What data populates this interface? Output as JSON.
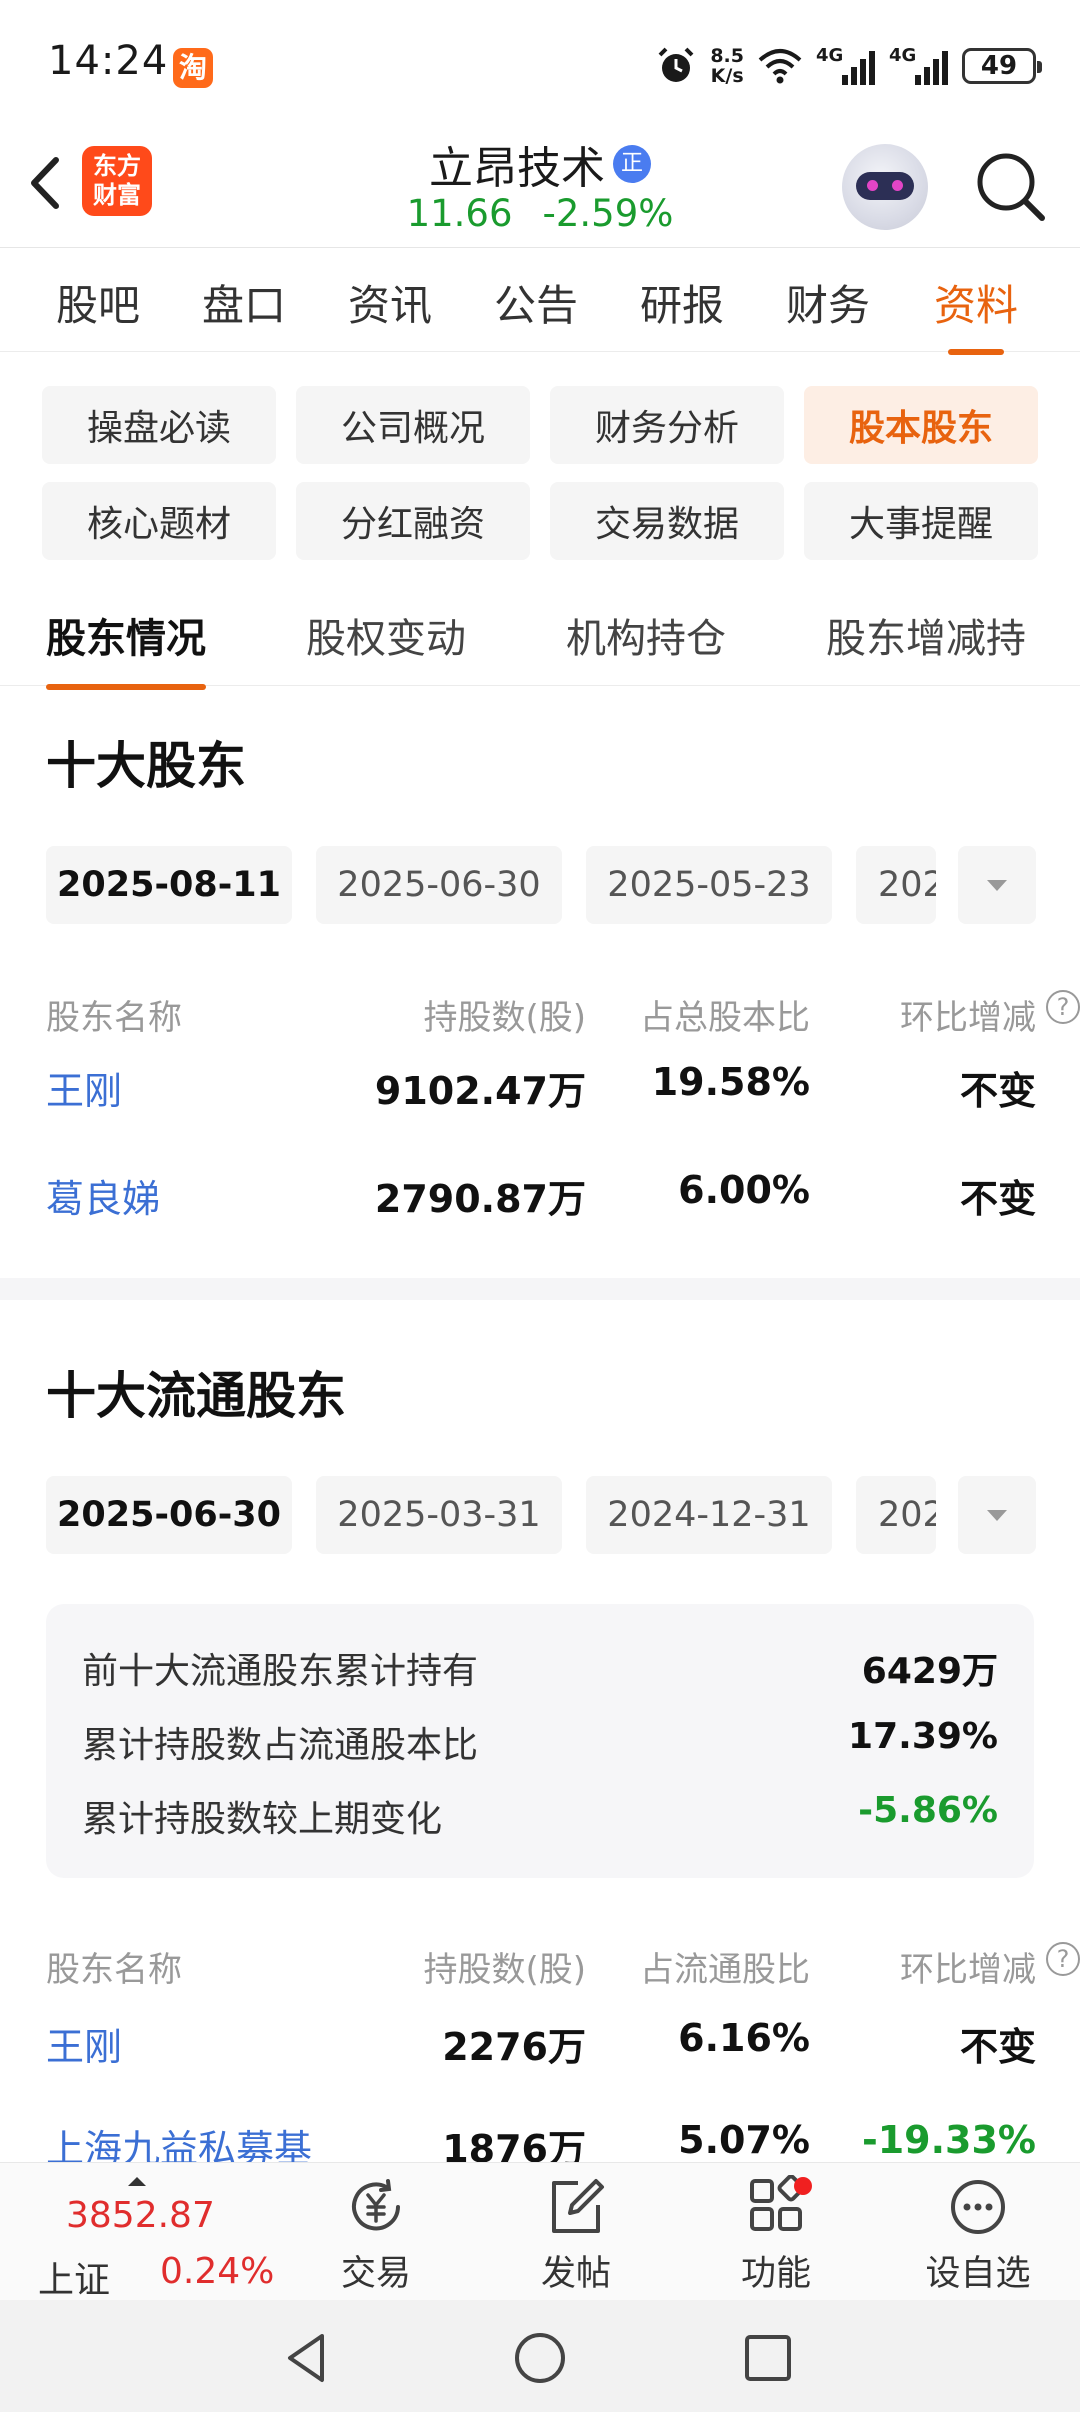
{
  "status_bar": {
    "time": "14:24",
    "taobao_glyph": "淘",
    "net_speed_value": "8.5",
    "net_speed_unit": "K/s",
    "signal1": "4G",
    "signal2": "4G",
    "battery": "49",
    "icons": [
      "alarm-icon",
      "wifi-icon",
      "signal-icon",
      "battery-icon"
    ]
  },
  "header": {
    "logo_line1": "东方",
    "logo_line2": "财富",
    "title": "立昂技术",
    "badge": "正",
    "price": "11.66",
    "change_pct": "-2.59%"
  },
  "main_tabs": [
    "股吧",
    "盘口",
    "资讯",
    "公告",
    "研报",
    "财务",
    "资料"
  ],
  "active_main_tab": "资料",
  "chips": [
    "操盘必读",
    "公司概况",
    "财务分析",
    "股本股东",
    "核心题材",
    "分红融资",
    "交易数据",
    "大事提醒"
  ],
  "active_chip": "股本股东",
  "sub_tabs": [
    "股东情况",
    "股权变动",
    "机构持仓",
    "股东增减持"
  ],
  "top10": {
    "title": "十大股东",
    "dates": [
      "2025-08-11",
      "2025-06-30",
      "2025-05-23",
      "202"
    ],
    "headers": [
      "股东名称",
      "持股数(股)",
      "占总股本比",
      "环比增减"
    ],
    "rows": [
      {
        "name": "王刚",
        "shares": "9102.47万",
        "pct": "19.58%",
        "change": "不变"
      },
      {
        "name": "葛良娣",
        "shares": "2790.87万",
        "pct": "6.00%",
        "change": "不变"
      }
    ]
  },
  "top10_float": {
    "title": "十大流通股东",
    "dates": [
      "2025-06-30",
      "2025-03-31",
      "2024-12-31",
      "202"
    ],
    "summary": [
      {
        "label": "前十大流通股东累计持有",
        "value": "6429万"
      },
      {
        "label": "累计持股数占流通股本比",
        "value": "17.39%"
      },
      {
        "label": "累计持股数较上期变化",
        "value": "-5.86%"
      }
    ],
    "headers": [
      "股东名称",
      "持股数(股)",
      "占流通股比",
      "环比增减"
    ],
    "rows": [
      {
        "name": "王刚",
        "shares": "2276万",
        "pct": "6.16%",
        "change": "不变"
      },
      {
        "name": "上海九益私募基",
        "shares": "1876万",
        "pct": "5.07%",
        "change": "-19.33%"
      }
    ]
  },
  "qmark": "?",
  "bottom_bar": {
    "index_value": "3852.87",
    "index_name": "上证",
    "index_pct": "0.24%",
    "items": [
      "交易",
      "发帖",
      "功能",
      "设自选"
    ]
  },
  "colors": {
    "accent": "#e8630f",
    "rise": "#e02d2d",
    "fall": "#1a9b2e",
    "link": "#3b6fd4"
  }
}
